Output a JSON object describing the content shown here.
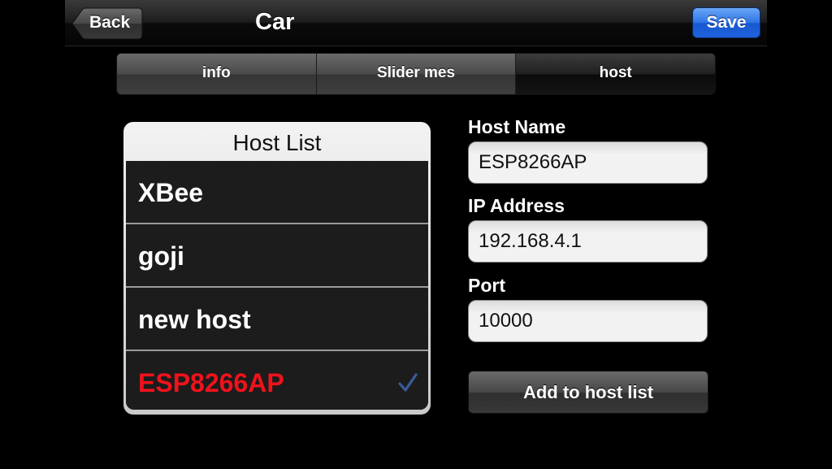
{
  "navbar": {
    "back_label": "Back",
    "title": "Car",
    "save_label": "Save"
  },
  "tabs": [
    {
      "label": "info",
      "selected": false
    },
    {
      "label": "Slider mes",
      "selected": false
    },
    {
      "label": "host",
      "selected": true
    }
  ],
  "host_list": {
    "title": "Host List",
    "items": [
      {
        "label": "XBee",
        "selected": false
      },
      {
        "label": "goji",
        "selected": false
      },
      {
        "label": "new host",
        "selected": false
      },
      {
        "label": "ESP8266AP",
        "selected": true
      }
    ]
  },
  "form": {
    "host_name_label": "Host Name",
    "host_name_value": "ESP8266AP",
    "ip_label": "IP Address",
    "ip_value": "192.168.4.1",
    "port_label": "Port",
    "port_value": "10000",
    "add_button_label": "Add to host list"
  },
  "colors": {
    "selected_host": "#f0121b",
    "checkmark": "#3a5a9c",
    "save_button": "#2c74e6"
  },
  "icons": {
    "back": "back-arrow-icon",
    "check": "checkmark-icon"
  }
}
